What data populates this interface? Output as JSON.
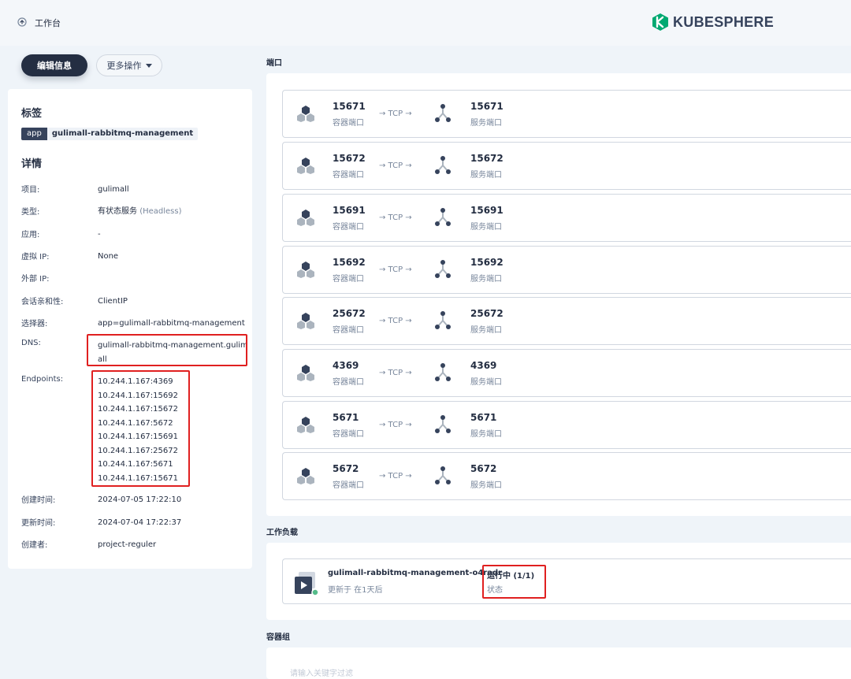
{
  "header": {
    "nav_label": "工作台",
    "brand": "KUBESPHERE",
    "brand_color": "#00a971"
  },
  "actions": {
    "edit_label": "编辑信息",
    "more_label": "更多操作"
  },
  "labels": {
    "title": "标签",
    "items": [
      {
        "key": "app",
        "value": "gulimall-rabbitmq-management"
      }
    ]
  },
  "details": {
    "title": "详情",
    "project": {
      "label": "项目:",
      "value": "gulimall"
    },
    "type": {
      "label": "类型:",
      "value": "有状态服务",
      "note": "(Headless)"
    },
    "app": {
      "label": "应用:",
      "value": "-"
    },
    "virtual_ip": {
      "label": "虚拟 IP:",
      "value": "None"
    },
    "external_ip": {
      "label": "外部 IP:",
      "value": ""
    },
    "session_affinity": {
      "label": "会话亲和性:",
      "value": "ClientIP"
    },
    "selector": {
      "label": "选择器:",
      "value": "app=gulimall-rabbitmq-management"
    },
    "dns": {
      "label": "DNS:",
      "line1": "gulimall-rabbitmq-management.gulim",
      "line2": "all"
    },
    "endpoints": {
      "label": "Endpoints:",
      "values": [
        "10.244.1.167:4369",
        "10.244.1.167:15692",
        "10.244.1.167:15672",
        "10.244.1.167:5672",
        "10.244.1.167:15691",
        "10.244.1.167:25672",
        "10.244.1.167:5671",
        "10.244.1.167:15671"
      ]
    },
    "created_at": {
      "label": "创建时间:",
      "value": "2024-07-05 17:22:10"
    },
    "updated_at": {
      "label": "更新时间:",
      "value": "2024-07-04 17:22:37"
    },
    "creator": {
      "label": "创建者:",
      "value": "project-reguler"
    }
  },
  "ports": {
    "title": "端口",
    "container_label": "容器端口",
    "service_label": "服务端口",
    "protocol_label": "→ TCP →",
    "items": [
      {
        "container": "15671",
        "service": "15671"
      },
      {
        "container": "15672",
        "service": "15672"
      },
      {
        "container": "15691",
        "service": "15691"
      },
      {
        "container": "15692",
        "service": "15692"
      },
      {
        "container": "25672",
        "service": "25672"
      },
      {
        "container": "4369",
        "service": "4369"
      },
      {
        "container": "5671",
        "service": "5671"
      },
      {
        "container": "5672",
        "service": "5672"
      }
    ]
  },
  "workload": {
    "title": "工作负载",
    "name": "gulimall-rabbitmq-management-o4radr",
    "updated": "更新于 在1天后",
    "status": "运行中 (1/1)",
    "status_label": "状态",
    "status_color": "#55bc8a"
  },
  "pods": {
    "title": "容器组",
    "search_placeholder": "请输入关键字过滤"
  },
  "highlight_color": "#e02020"
}
